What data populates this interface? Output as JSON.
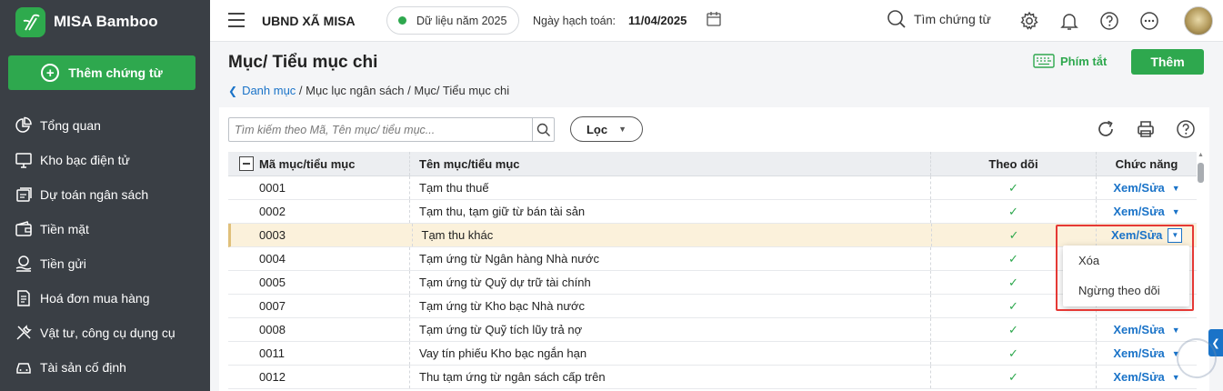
{
  "sidebar": {
    "brand": "MISA Bamboo",
    "add_voucher_label": "Thêm chứng từ",
    "items": [
      {
        "label": "Tổng quan",
        "icon": "pie-chart-icon"
      },
      {
        "label": "Kho bạc điện tử",
        "icon": "monitor-icon"
      },
      {
        "label": "Dự toán ngân sách",
        "icon": "budget-icon"
      },
      {
        "label": "Tiền mặt",
        "icon": "wallet-icon"
      },
      {
        "label": "Tiền gửi",
        "icon": "deposit-icon"
      },
      {
        "label": "Hoá đơn mua hàng",
        "icon": "invoice-icon"
      },
      {
        "label": "Vật tư, công cụ dụng cụ",
        "icon": "tools-icon"
      },
      {
        "label": "Tài sản cố định",
        "icon": "car-icon"
      }
    ]
  },
  "header": {
    "org_name": "UBND XÃ MISA",
    "data_year": "Dữ liệu năm 2025",
    "accounting_date_label": "Ngày hạch toán:",
    "accounting_date": "11/04/2025",
    "search_label": "Tìm chứng từ"
  },
  "page": {
    "title": "Mục/ Tiểu mục chi",
    "breadcrumb_link": "Danh mục",
    "breadcrumb_rest": " / Mục lục ngân sách / Mục/ Tiểu mục chi",
    "shortcut_label": "Phím tắt",
    "add_button": "Thêm"
  },
  "toolbar": {
    "search_placeholder": "Tìm kiếm theo Mã, Tên mục/ tiểu mục...",
    "filter_label": "Lọc"
  },
  "table": {
    "columns": [
      "Mã mục/tiểu mục",
      "Tên mục/tiểu mục",
      "Theo dõi",
      "Chức năng"
    ],
    "action_label": "Xem/Sửa",
    "rows": [
      {
        "code": "0001",
        "name": "Tạm thu thuế",
        "tracked": true
      },
      {
        "code": "0002",
        "name": "Tạm thu, tạm giữ từ bán tài sản",
        "tracked": true
      },
      {
        "code": "0003",
        "name": "Tạm thu khác",
        "tracked": true
      },
      {
        "code": "0004",
        "name": "Tạm ứng từ Ngân hàng Nhà nước",
        "tracked": true
      },
      {
        "code": "0005",
        "name": "Tạm ứng từ Quỹ dự trữ tài chính",
        "tracked": true
      },
      {
        "code": "0007",
        "name": "Tạm ứng từ Kho bạc Nhà nước",
        "tracked": true
      },
      {
        "code": "0008",
        "name": "Tạm ứng từ Quỹ tích lũy trả nợ",
        "tracked": true
      },
      {
        "code": "0011",
        "name": "Vay tín phiếu Kho bạc ngắn hạn",
        "tracked": true
      },
      {
        "code": "0012",
        "name": "Thu tạm ứng từ ngân sách cấp trên",
        "tracked": true
      }
    ]
  },
  "menu": {
    "delete": "Xóa",
    "stop_tracking": "Ngừng theo dõi"
  },
  "colors": {
    "brand_green": "#2ea84e",
    "sidebar_bg": "#3a3f45",
    "link_blue": "#1a73c8",
    "selected_row": "#fbf1db",
    "highlight_red": "#e53935"
  }
}
